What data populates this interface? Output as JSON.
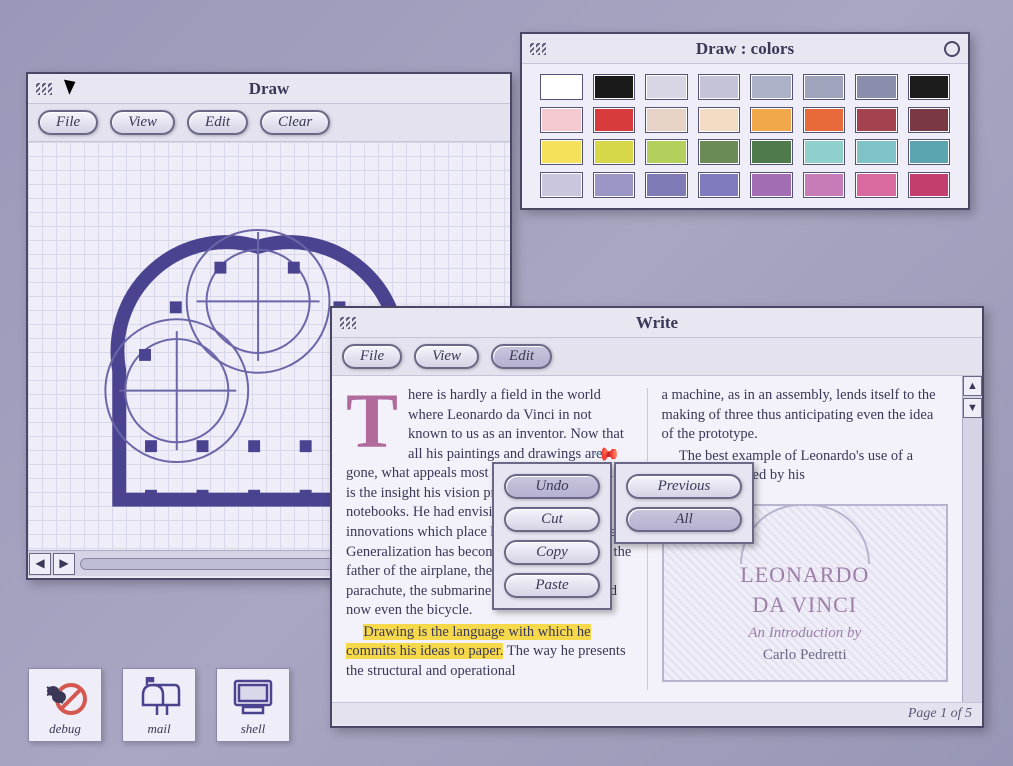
{
  "windows": {
    "draw": {
      "title": "Draw",
      "buttons": {
        "file": "File",
        "view": "View",
        "edit": "Edit",
        "clear": "Clear"
      }
    },
    "colors": {
      "title": "Draw : colors",
      "palette": [
        "#ffffff",
        "#1a1a1a",
        "#d8d5e5",
        "#c5c3d8",
        "#aeb2c8",
        "#9fa3bc",
        "#8a8eac",
        "#1c1c1c",
        "#f4c9cf",
        "#d73b3b",
        "#e7d2c8",
        "#f3dcc3",
        "#f0a84a",
        "#e86a3a",
        "#a4434f",
        "#7a3842",
        "#f4e35a",
        "#d6d84a",
        "#b3cf5c",
        "#6a8a56",
        "#4f7a4c",
        "#8fd0cd",
        "#7fc2c8",
        "#5aa5af",
        "#c9c6dd",
        "#9a96c6",
        "#7f7bb6",
        "#807abf",
        "#a36db4",
        "#c77bb7",
        "#d86aa0",
        "#c43d6f"
      ]
    },
    "write": {
      "title": "Write",
      "buttons": {
        "file": "File",
        "view": "View",
        "edit": "Edit"
      },
      "edit_menu": {
        "undo": "Undo",
        "cut": "Cut",
        "copy": "Copy",
        "paste": "Paste"
      },
      "undo_submenu": {
        "previous": "Previous",
        "all": "All"
      },
      "body": {
        "dropcap": "T",
        "para1": "here is hardly a field in the world where Leonardo da Vinci in not known to us as an inventor. Now that all his paintings and drawings are gone, what appeals most to our own imagination is the insight his vision provided by his notebooks. He had envisioned technological innovations which place him ahead of his time. Generalization has become unavoidable. He's the father of the airplane, the helicopter, the parachute, the submarine, the auto mobile, and now even the bicycle.",
        "hl": "Drawing is the language with which he commits his ideas to paper.",
        "para1_tail": " The way he presents the structural and operational",
        "col2_frag1": "a machine, as in an assembly, lends itself to the making of three thus anticipating even the idea of the prototype.",
        "col2_frag2": "The best example of Leonardo's use of a model is provided by his",
        "book_title1": "LEONARDO",
        "book_title2": "DA VINCI",
        "book_sub": "An Introduction by",
        "book_author": "Carlo Pedretti"
      },
      "footer": "Page 1 of 5"
    }
  },
  "desktop_icons": {
    "debug": "debug",
    "mail": "mail",
    "shell": "shell"
  }
}
